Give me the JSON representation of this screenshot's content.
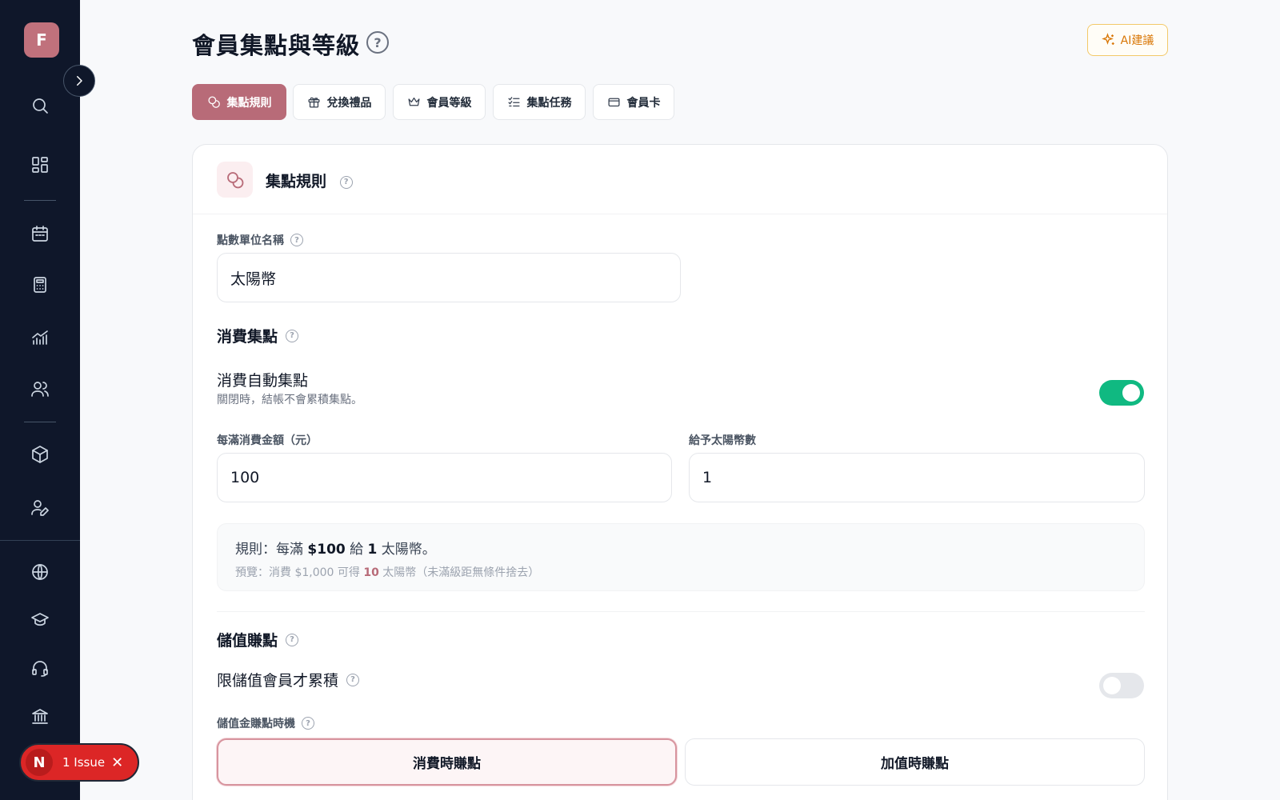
{
  "sidebar": {
    "avatar_letter": "F",
    "icons": [
      "search-icon",
      "dashboard-icon",
      "calendar-icon",
      "calculator-icon",
      "analytics-icon",
      "users-icon",
      "package-icon",
      "user-edit-icon",
      "globe-icon",
      "graduation-cap-icon",
      "headset-icon",
      "bank-icon"
    ]
  },
  "header": {
    "title": "會員集點與等級",
    "ai_button": "AI建議"
  },
  "tabs": [
    {
      "label": "集點規則",
      "icon": "coins-icon",
      "active": true
    },
    {
      "label": "兌換禮品",
      "icon": "gift-icon",
      "active": false
    },
    {
      "label": "會員等級",
      "icon": "crown-icon",
      "active": false
    },
    {
      "label": "集點任務",
      "icon": "checklist-icon",
      "active": false
    },
    {
      "label": "會員卡",
      "icon": "card-icon",
      "active": false
    }
  ],
  "card": {
    "title": "集點規則",
    "unit_name_label": "點數單位名稱",
    "unit_name_value": "太陽幣",
    "spend_section_title": "消費集點",
    "auto_points_title": "消費自動集點",
    "auto_points_desc": "關閉時，結帳不會累積集點。",
    "auto_points_on": true,
    "spend_amount_label": "每滿消費金額（元）",
    "spend_amount_value": "100",
    "points_given_label": "給予太陽幣數",
    "points_given_value": "1",
    "rule_prefix": "規則：每滿 ",
    "rule_amount": "$100",
    "rule_mid": " 給 ",
    "rule_points": "1",
    "rule_suffix": " 太陽幣。",
    "preview_prefix": "預覽：消費 $1,000 可得 ",
    "preview_points": "10",
    "preview_suffix": " 太陽幣（未滿級距無條件捨去）",
    "stored_section_title": "儲值賺點",
    "stored_only_title": "限儲值會員才累積",
    "stored_only_on": false,
    "timing_label": "儲值金賺點時機",
    "timing_option_1": "消費時賺點",
    "timing_option_2": "加值時賺點"
  },
  "issue": {
    "letter": "N",
    "text": "1 Issue"
  },
  "colors": {
    "sidebar_bg": "#0f172a",
    "accent": "#b86b78",
    "toggle_on": "#10b981",
    "ai_accent": "#d97706",
    "issue_red": "#dc2626"
  }
}
